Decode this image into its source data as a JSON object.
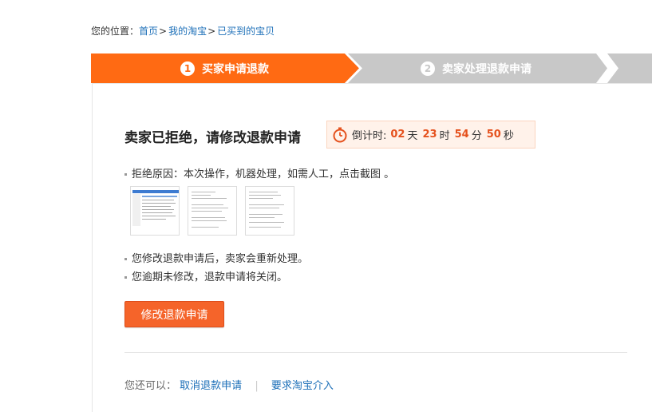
{
  "breadcrumb": {
    "prefix": "您的位置：",
    "items": [
      "首页",
      "我的淘宝",
      "已买到的宝贝"
    ],
    "separator": ">"
  },
  "steps": [
    {
      "number": "1",
      "label": "买家申请退款",
      "active": true
    },
    {
      "number": "2",
      "label": "卖家处理退款申请",
      "active": false
    }
  ],
  "status": {
    "title": "卖家已拒绝，请修改退款申请",
    "countdown": {
      "label": "倒计时:",
      "days": "02",
      "days_unit": "天",
      "hours": "23",
      "hours_unit": "时",
      "minutes": "54",
      "minutes_unit": "分",
      "seconds": "50",
      "seconds_unit": "秒"
    }
  },
  "reason": {
    "text": "拒绝原因：本次操作，机器处理，如需人工，点击截图 。"
  },
  "notes": [
    "您修改退款申请后，卖家会重新处理。",
    "您逾期未修改，退款申请将关闭。"
  ],
  "actions": {
    "modify_label": "修改退款申请"
  },
  "footer": {
    "prefix": "您还可以：",
    "cancel_label": "取消退款申请",
    "pipe": "|",
    "intervene_label": "要求淘宝介入"
  },
  "colors": {
    "accent": "#ff6a13",
    "inactive_step": "#c8c8c8",
    "link": "#1c6fb8",
    "countdown_number": "#e5511d"
  }
}
